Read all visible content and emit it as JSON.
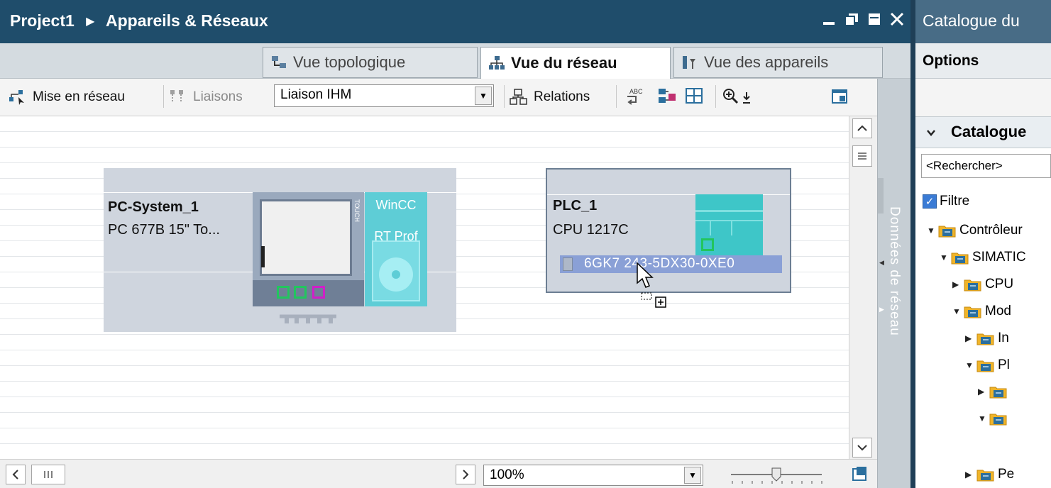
{
  "editor": {
    "breadcrumb": [
      "Project1",
      "Appareils & Réseaux"
    ],
    "breadcrumb_separator": "▶",
    "tabs": [
      {
        "label": "Vue topologique"
      },
      {
        "label": "Vue du réseau"
      },
      {
        "label": "Vue des appareils"
      }
    ],
    "toolbar": {
      "network_label": "Mise en réseau",
      "connections_label": "Liaisons",
      "connection_type": "Liaison IHM",
      "relations_label": "Relations"
    },
    "devices": {
      "pc": {
        "name": "PC-System_1",
        "type": "PC 677B 15\" To...",
        "app_line1": "WinCC",
        "app_line2": "RT Prof",
        "touch_label": "TOUCH"
      },
      "plc": {
        "name": "PLC_1",
        "type": "CPU 1217C",
        "module": "6GK7 243-5DX30-0XE0"
      }
    },
    "side_panel_label": "Données de réseau",
    "zoom": "100%"
  },
  "catalog": {
    "title": "Catalogue du",
    "options_label": "Options",
    "section_label": "Catalogue",
    "search_placeholder": "<Rechercher>",
    "filter_label": "Filtre",
    "tree": [
      {
        "label": "Contrôleur",
        "expanded": true
      },
      {
        "label": "SIMATIC",
        "expanded": true
      },
      {
        "label": "CPU",
        "expanded": false
      },
      {
        "label": "Mod",
        "expanded": true
      },
      {
        "label": "In",
        "expanded": false
      },
      {
        "label": "Pl",
        "expanded": true
      },
      {
        "label": "",
        "expanded": false
      },
      {
        "label": "",
        "expanded": true
      },
      {
        "label": "Pe",
        "expanded": false
      }
    ]
  },
  "colors": {
    "title_bar": "#1f4d6b",
    "device_box": "#cfd5de",
    "module_teal": "#5ecdd6",
    "port_green": "#22c55e",
    "port_magenta": "#d020c8",
    "selection_blue": "#8aa0d6"
  }
}
